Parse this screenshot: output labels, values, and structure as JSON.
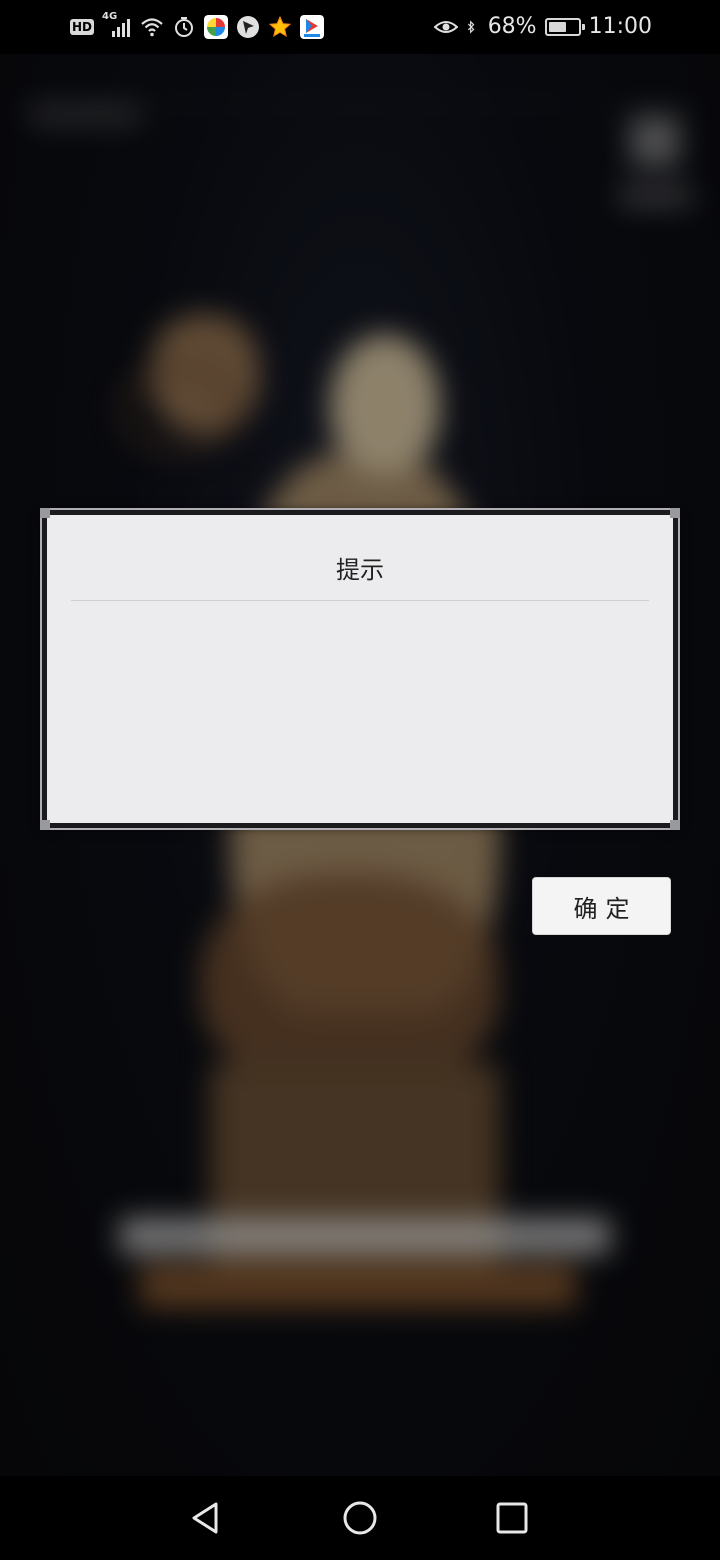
{
  "status_bar": {
    "hd_label": "HD",
    "network_label": "4G",
    "battery_percent_text": "68%",
    "battery_level": 0.68,
    "time": "11:00",
    "icons": [
      "hd-icon",
      "signal-icon",
      "wifi-icon",
      "alarm-icon",
      "app-icon-pinwheel",
      "app-icon-arrow",
      "app-icon-star",
      "app-icon-video",
      "eye-icon",
      "bluetooth-icon",
      "battery-icon"
    ]
  },
  "dialog": {
    "title": "提示",
    "message": ""
  },
  "confirm_button": {
    "label": "确定"
  },
  "nav_bar": {
    "icons": [
      "back-icon",
      "home-icon",
      "recent-apps-icon"
    ]
  },
  "colors": {
    "dialog_background": "#ececee",
    "page_background": "#0b0b0e",
    "status_bar_background": "#000000"
  }
}
